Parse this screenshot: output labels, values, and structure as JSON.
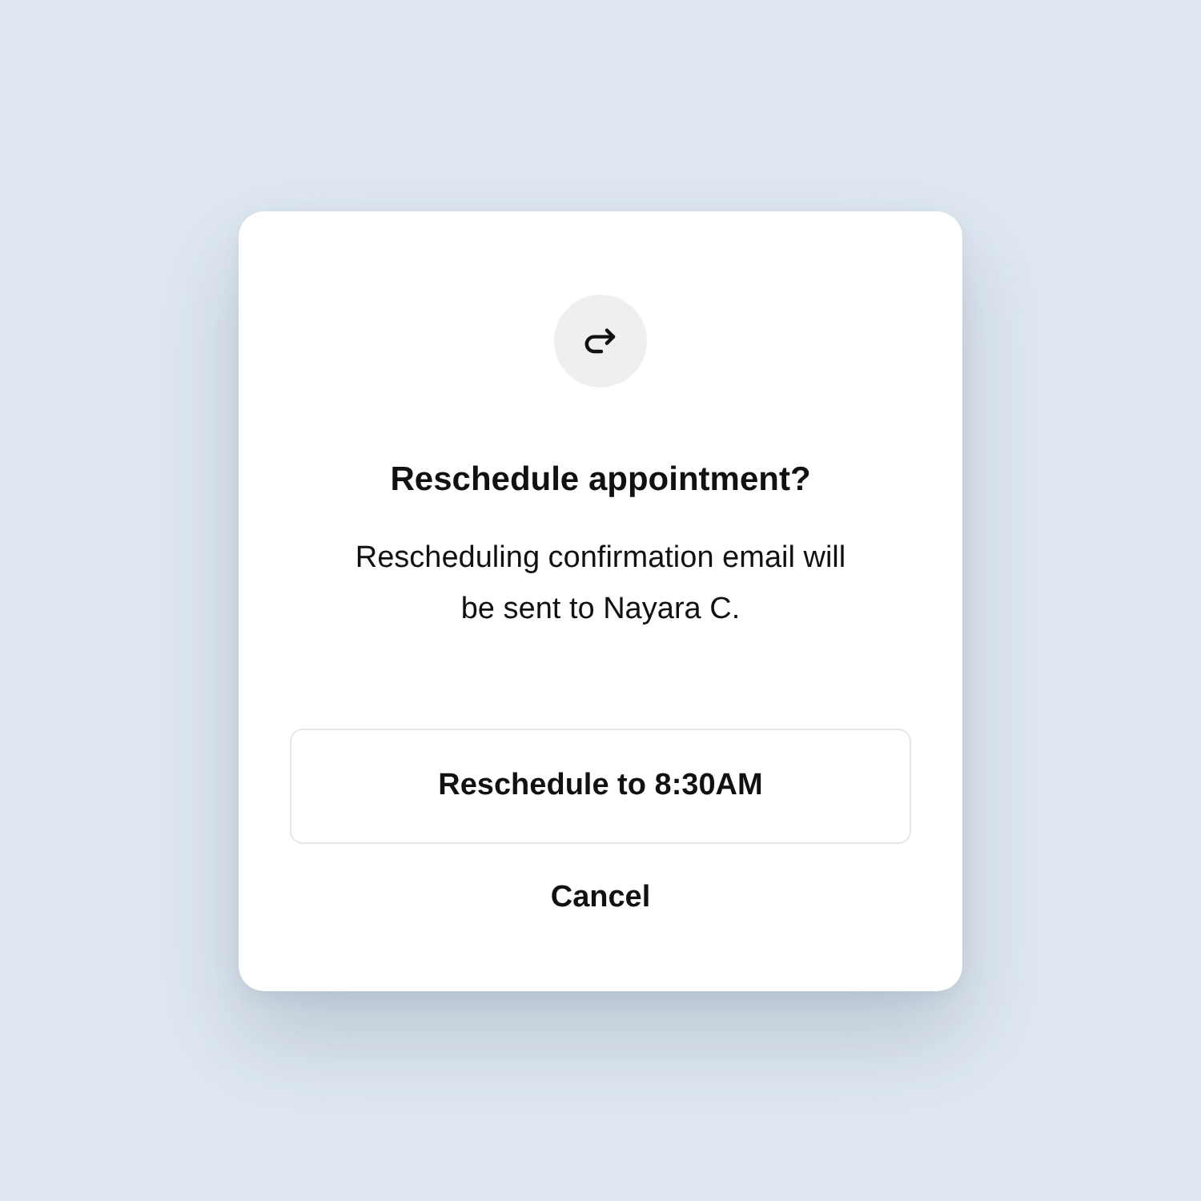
{
  "dialog": {
    "title": "Reschedule appointment?",
    "message": "Rescheduling confirmation email will be sent to Nayara C.",
    "buttons": [
      {
        "label": "Reschedule to 8:30AM",
        "kind": "outlined"
      },
      {
        "label": "Cancel",
        "kind": "plain"
      }
    ]
  }
}
